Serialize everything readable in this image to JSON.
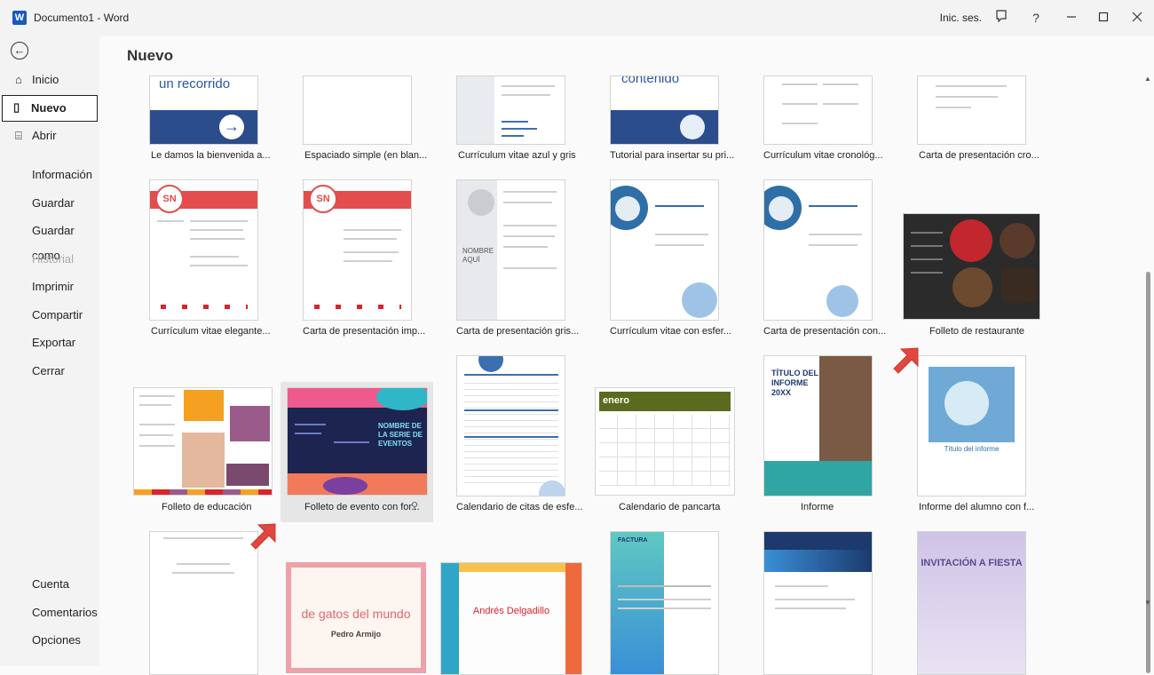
{
  "titlebar": {
    "app_icon": "word-icon",
    "doc_title": "Documento1  -  Word",
    "sign_in": "Inic. ses.",
    "feedback_icon": "feedback-icon",
    "help": "?",
    "minimize_icon": "minimize-icon",
    "maximize_icon": "maximize-icon",
    "close_icon": "close-icon"
  },
  "sidebar": {
    "back_icon": "back-arrow-icon",
    "items": [
      {
        "label": "Inicio",
        "icon": "home-icon"
      },
      {
        "label": "Nuevo",
        "icon": "new-document-icon"
      },
      {
        "label": "Abrir",
        "icon": "folder-open-icon"
      },
      {
        "label": "Información"
      },
      {
        "label": "Guardar"
      },
      {
        "label": "Guardar como"
      },
      {
        "label": "Historial"
      },
      {
        "label": "Imprimir"
      },
      {
        "label": "Compartir"
      },
      {
        "label": "Exportar"
      },
      {
        "label": "Cerrar"
      },
      {
        "label": "Cuenta"
      },
      {
        "label": "Comentarios"
      },
      {
        "label": "Opciones"
      }
    ]
  },
  "main": {
    "heading": "Nuevo",
    "templates": [
      {
        "caption": "Le damos la bienvenida a...",
        "thumb_text": "un recorrido"
      },
      {
        "caption": "Espaciado simple (en blan..."
      },
      {
        "caption": "Currículum vitae azul y gris"
      },
      {
        "caption": "Tutorial para insertar su pri...",
        "thumb_text": "contenido"
      },
      {
        "caption": "Currículum vitae cronológ..."
      },
      {
        "caption": "Carta de presentación cro..."
      },
      {
        "caption": "Currículum vitae elegante...",
        "thumb_text": "SN"
      },
      {
        "caption": "Carta de presentación imp...",
        "thumb_text": "SN"
      },
      {
        "caption": "Carta de presentación gris...",
        "thumb_text": "NOMBRE AQUÍ"
      },
      {
        "caption": "Currículum vitae con esfer..."
      },
      {
        "caption": "Carta de presentación con..."
      },
      {
        "caption": "Folleto de restaurante"
      },
      {
        "caption": "Folleto de educación"
      },
      {
        "caption": "Folleto de evento con for...",
        "thumb_text": "NOMBRE DE LA SERIE DE EVENTOS"
      },
      {
        "caption": "Calendario de citas de esfe..."
      },
      {
        "caption": "Calendario de pancarta",
        "thumb_text": "enero"
      },
      {
        "caption": "Informe",
        "thumb_text": "TÍTULO DEL INFORME 20XX"
      },
      {
        "caption": "Informe del alumno con f...",
        "thumb_text": "Título del informe"
      },
      {
        "caption": ""
      },
      {
        "caption": "",
        "thumb_text": "de gatos del mundo",
        "thumb_sub": "Pedro Armijo"
      },
      {
        "caption": "",
        "thumb_text": "Andrés Delgadillo"
      },
      {
        "caption": "",
        "thumb_text": "FACTURA"
      },
      {
        "caption": ""
      },
      {
        "caption": "",
        "thumb_text": "INVITACIÓN A FIESTA"
      }
    ],
    "pin_icon": "pin-icon"
  },
  "colors": {
    "accent_red": "#d9242b",
    "word_blue": "#185abd",
    "arrow_red": "#e0473e"
  }
}
